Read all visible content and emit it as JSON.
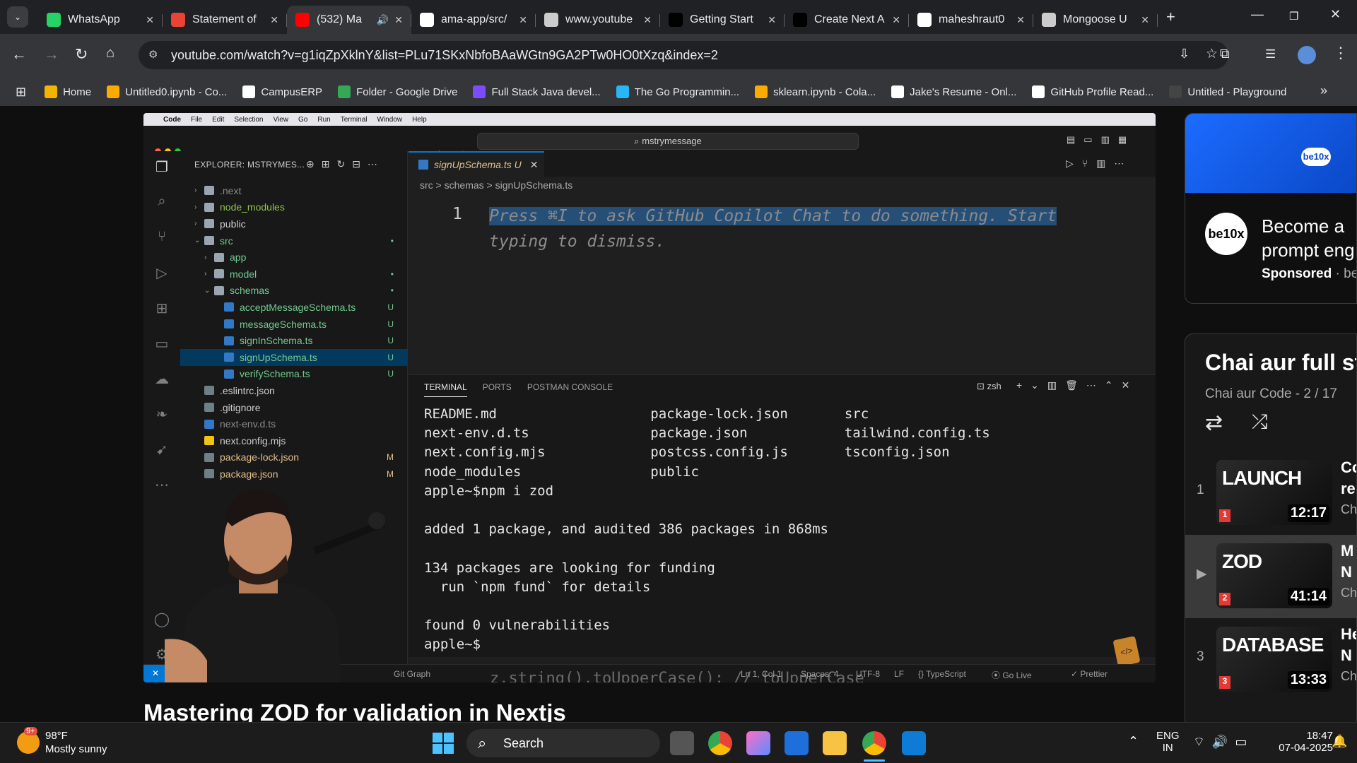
{
  "browser": {
    "tabs": [
      {
        "title": "WhatsApp",
        "icon": "whatsapp-icon",
        "color": "#25d366"
      },
      {
        "title": "Statement of",
        "icon": "gmail-icon",
        "color": "#ea4335"
      },
      {
        "title": "(532) Ma",
        "icon": "youtube-icon",
        "color": "#ff0000"
      },
      {
        "title": "ama-app/src/",
        "icon": "github-icon",
        "color": "#ffffff"
      },
      {
        "title": "www.youtube",
        "icon": "globe-icon",
        "color": "#cccccc"
      },
      {
        "title": "Getting Start",
        "icon": "nextjs-icon",
        "color": "#000000"
      },
      {
        "title": "Create Next A",
        "icon": "vercel-icon",
        "color": "#000000"
      },
      {
        "title": "maheshraut0",
        "icon": "github-icon",
        "color": "#ffffff"
      },
      {
        "title": "Mongoose U",
        "icon": "globe-icon",
        "color": "#cccccc"
      }
    ],
    "url": "youtube.com/watch?v=g1iqZpXklnY&list=PLu71SKxNbfoBAaWGtn9GA2PTw0HO0tXzq&index=2",
    "bookmarks": [
      {
        "label": "Home",
        "color": "#f4b400"
      },
      {
        "label": "Untitled0.ipynb - Co...",
        "color": "#f9ab00"
      },
      {
        "label": "CampusERP",
        "color": "#ffffff"
      },
      {
        "label": "Folder - Google Drive",
        "color": "#34a853"
      },
      {
        "label": "Full Stack Java devel...",
        "color": "#7c4dff"
      },
      {
        "label": "The Go Programmin...",
        "color": "#29b6f6"
      },
      {
        "label": "sklearn.ipynb - Cola...",
        "color": "#f9ab00"
      },
      {
        "label": "Jake's Resume - Onl...",
        "color": "#ffffff"
      },
      {
        "label": "GitHub Profile Read...",
        "color": "#ffffff"
      },
      {
        "label": "Untitled - Playground",
        "color": "#444444"
      }
    ]
  },
  "video": {
    "mac_menu": [
      "Code",
      "File",
      "Edit",
      "Selection",
      "View",
      "Go",
      "Run",
      "Terminal",
      "Window",
      "Help"
    ],
    "vscode": {
      "search": "mstrymessage",
      "explorer_header": "EXPLORER: MSTRYMES...",
      "tree": [
        {
          "label": ".next",
          "level": 0,
          "type": "folder",
          "color": "#8a8a8a",
          "badge": ""
        },
        {
          "label": "node_modules",
          "level": 0,
          "type": "folder",
          "color": "#8bc34a",
          "badge": ""
        },
        {
          "label": "public",
          "level": 0,
          "type": "folder",
          "color": "#ccc",
          "badge": ""
        },
        {
          "label": "src",
          "level": 0,
          "type": "folder-open",
          "color": "#73c991",
          "badge": "•"
        },
        {
          "label": "app",
          "level": 1,
          "type": "folder",
          "color": "#73c991",
          "badge": ""
        },
        {
          "label": "model",
          "level": 1,
          "type": "folder",
          "color": "#73c991",
          "badge": "•"
        },
        {
          "label": "schemas",
          "level": 1,
          "type": "folder-open",
          "color": "#73c991",
          "badge": "•"
        },
        {
          "label": "acceptMessageSchema.ts",
          "level": 2,
          "type": "ts",
          "color": "#73c991",
          "badge": "U"
        },
        {
          "label": "messageSchema.ts",
          "level": 2,
          "type": "ts",
          "color": "#73c991",
          "badge": "U"
        },
        {
          "label": "signInSchema.ts",
          "level": 2,
          "type": "ts",
          "color": "#73c991",
          "badge": "U"
        },
        {
          "label": "signUpSchema.ts",
          "level": 2,
          "type": "ts",
          "color": "#73c991",
          "badge": "U"
        },
        {
          "label": "verifySchema.ts",
          "level": 2,
          "type": "ts",
          "color": "#73c991",
          "badge": "U"
        },
        {
          "label": ".eslintrc.json",
          "level": 0,
          "type": "file",
          "color": "#ccc",
          "badge": ""
        },
        {
          "label": ".gitignore",
          "level": 0,
          "type": "file",
          "color": "#ccc",
          "badge": ""
        },
        {
          "label": "next-env.d.ts",
          "level": 0,
          "type": "ts",
          "color": "#8a8a8a",
          "badge": ""
        },
        {
          "label": "next.config.mjs",
          "level": 0,
          "type": "js",
          "color": "#ccc",
          "badge": ""
        },
        {
          "label": "package-lock.json",
          "level": 0,
          "type": "file",
          "color": "#e2c08d",
          "badge": "M"
        },
        {
          "label": "package.json",
          "level": 0,
          "type": "file",
          "color": "#e2c08d",
          "badge": "M"
        }
      ],
      "tab": "signUpSchema.ts  U",
      "breadcrumb": "src  >  schemas  >  signUpSchema.ts",
      "line_number": "1",
      "copilot_hint_1": "Press ⌘I to ask GitHub Copilot Chat to do something. Start",
      "copilot_hint_2": "typing to dismiss.",
      "panel_tabs": [
        "TERMINAL",
        "PORTS",
        "POSTMAN CONSOLE"
      ],
      "shell": "zsh",
      "terminal": [
        "README.md                   package-lock.json       src",
        "next-env.d.ts               package.json            tailwind.config.ts",
        "next.config.mjs             postcss.config.js       tsconfig.json",
        "node_modules                public",
        "apple~$npm i zod",
        "",
        "added 1 package, and audited 386 packages in 868ms",
        "",
        "134 packages are looking for funding",
        "  run `npm fund` for details",
        "",
        "found 0 vulnerabilities",
        "apple~$"
      ],
      "status": {
        "git_graph": "Git Graph",
        "position": "Ln 1, Col 1",
        "spaces": "Spaces: 4",
        "encoding": "UTF-8",
        "eol": "LF",
        "language": "TypeScript",
        "golive": "Go Live",
        "prettier": "Prettier"
      },
      "behind_code": "z.string().toUpperCase(); // toUpperCase"
    },
    "title": "Mastering ZOD for validation in Nextjs"
  },
  "ad": {
    "logo": "be10x",
    "headline": "Become a",
    "headline2": "prompt eng",
    "sponsored": "Sponsored",
    "brand": "be"
  },
  "playlist": {
    "title": "Chai aur full st",
    "subtitle": "Chai aur Code - 2 / 17",
    "items": [
      {
        "index": "1",
        "thumb": "LAUNCH",
        "duration": "12:17",
        "num": "1",
        "t1": "Co",
        "t2": "re",
        "t3": "Ch"
      },
      {
        "index": "▶",
        "thumb": "ZOD",
        "duration": "41:14",
        "num": "2",
        "t1": "M",
        "t2": "N",
        "t3": "Ch"
      },
      {
        "index": "3",
        "thumb": "DATABASE",
        "duration": "13:33",
        "num": "3",
        "t1": "He",
        "t2": "N",
        "t3": "Ch"
      }
    ]
  },
  "taskbar": {
    "weather_temp": "98°F",
    "weather_desc": "Mostly sunny",
    "weather_badge": "9+",
    "search": "Search",
    "lang1": "ENG",
    "lang2": "IN",
    "time": "18:47",
    "date": "07-04-2025"
  }
}
